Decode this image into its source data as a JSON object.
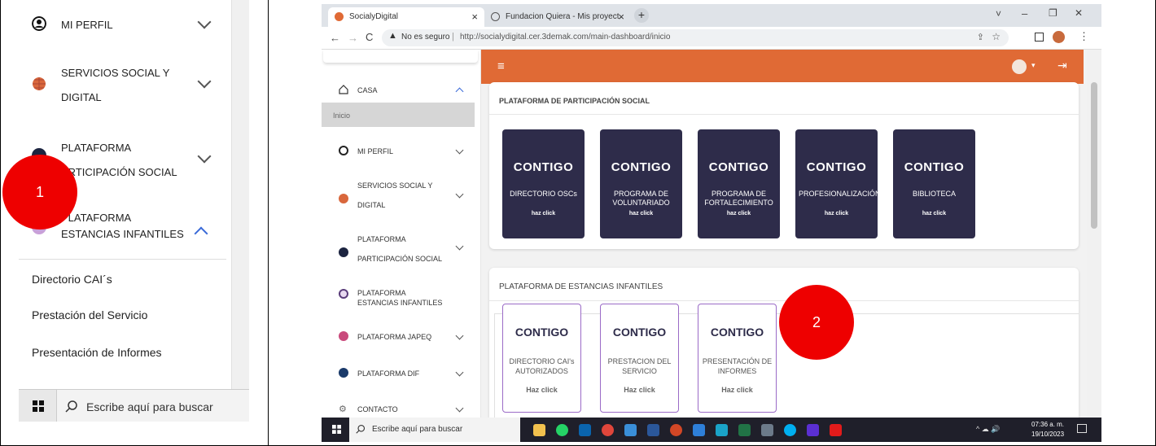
{
  "left_panel": {
    "items": [
      {
        "label": "MI PERFIL"
      },
      {
        "label_line1": "SERVICIOS SOCIAL Y",
        "label_line2": "DIGITAL"
      },
      {
        "label_line1": "PLATAFORMA",
        "label_line2": "ARTICIPACIÓN SOCIAL"
      },
      {
        "label_line1": "PLATAFORMA",
        "label_line2": "ESTANCIAS INFANTILES"
      }
    ],
    "subitems": [
      "Directorio CAI´s",
      "Prestación del Servicio",
      "Presentación de Informes"
    ],
    "badge": "1",
    "taskbar_search": "Escribe aquí para buscar"
  },
  "browser": {
    "tabs": [
      {
        "label": "SocialyDigital"
      },
      {
        "label": "Fundacion Quiera - Mis proyect"
      }
    ],
    "close_glyph": "×",
    "newtab_glyph": "+",
    "security_label": "No es seguro",
    "url": "http://socialydigital.cer.3demak.com/main-dashboard/inicio",
    "window_controls": [
      "˅",
      "–",
      "❐",
      "✕"
    ]
  },
  "sidebar": {
    "casa": "CASA",
    "inicio": "Inicio",
    "items": [
      {
        "label": "MI PERFIL"
      },
      {
        "line1": "SERVICIOS SOCIAL Y",
        "line2": "DIGITAL"
      },
      {
        "line1": "PLATAFORMA",
        "line2": "PARTICIPACIÓN SOCIAL"
      },
      {
        "line1": "PLATAFORMA",
        "line2": "ESTANCIAS INFANTILES"
      },
      {
        "label": "PLATAFORMA JAPEQ"
      },
      {
        "label": "PLATAFORMA DIF"
      },
      {
        "label": "CONTACTO"
      }
    ]
  },
  "main": {
    "section1_title": "PLATAFORMA DE PARTICIPACIÓN SOCIAL",
    "cards1": [
      {
        "logo": "CONTIGO",
        "title": "DIRECTORIO OSCs",
        "click": "haz click"
      },
      {
        "logo": "CONTIGO",
        "title": "PROGRAMA DE VOLUNTARIADO",
        "click": "haz click"
      },
      {
        "logo": "CONTIGO",
        "title": "PROGRAMA DE FORTALECIMIENTO",
        "click": "haz click"
      },
      {
        "logo": "CONTIGO",
        "title": "PROFESIONALIZACIÓN",
        "click": "haz click"
      },
      {
        "logo": "CONTIGO",
        "title": "BIBLIOTECA",
        "click": "haz click"
      }
    ],
    "section2_title": "PLATAFORMA DE ESTANCIAS INFANTILES",
    "cards2": [
      {
        "logo": "CONTIGO",
        "title": "DIRECTORIO CAI's AUTORIZADOS",
        "click": "Haz click"
      },
      {
        "logo": "CONTIGO",
        "title": "PRESTACION DEL SERVICIO",
        "click": "Haz click"
      },
      {
        "logo": "CONTIGO",
        "title": "PRESENTACIÓN DE INFORMES",
        "click": "Haz click"
      }
    ],
    "badge": "2"
  },
  "taskbar": {
    "search": "Escribe aquí para buscar",
    "time": "07:36 a. m.",
    "date": "19/10/2023"
  },
  "colors": {
    "accent": "#e06a35",
    "card": "#2e2c4a",
    "badge": "#ee0000",
    "purple": "#9b6bc7"
  }
}
